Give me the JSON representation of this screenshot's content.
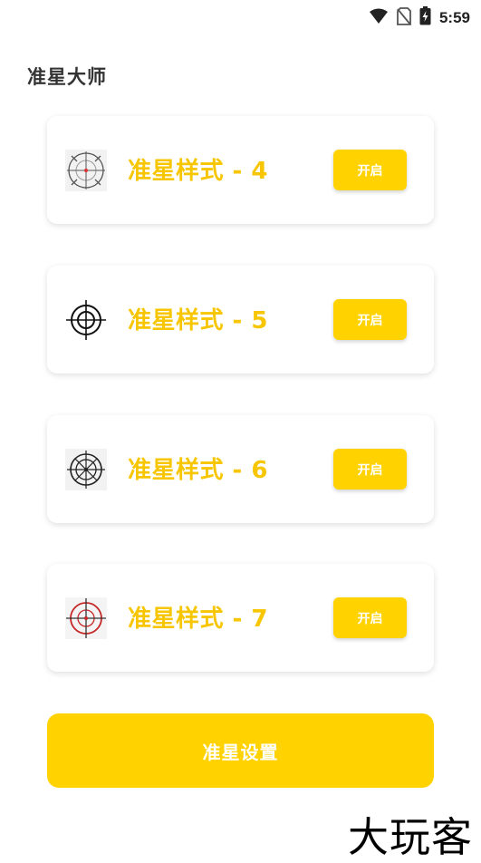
{
  "status_bar": {
    "time": "5:59",
    "icons": [
      "wifi-icon",
      "no-sim-icon",
      "battery-charging-icon"
    ]
  },
  "app": {
    "title": "准星大师"
  },
  "crosshair_styles": [
    {
      "title": "准星样式 - 4",
      "button_label": "开启",
      "icon": "crosshair-style-4-icon"
    },
    {
      "title": "准星样式 - 5",
      "button_label": "开启",
      "icon": "crosshair-style-5-icon"
    },
    {
      "title": "准星样式 - 6",
      "button_label": "开启",
      "icon": "crosshair-style-6-icon"
    },
    {
      "title": "准星样式 - 7",
      "button_label": "开启",
      "icon": "crosshair-style-7-icon"
    }
  ],
  "settings_button": {
    "label": "准星设置"
  },
  "watermark": {
    "text": "大玩客"
  },
  "colors": {
    "accent": "#ffd200",
    "title_yellow": "#f7c600",
    "background": "#ffffff"
  }
}
